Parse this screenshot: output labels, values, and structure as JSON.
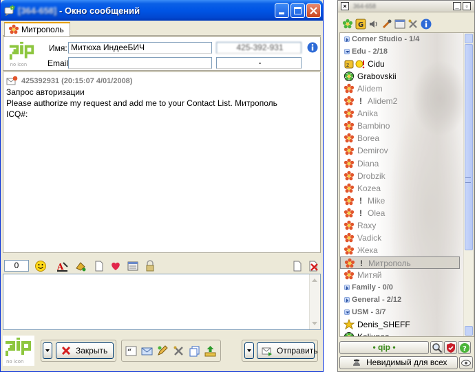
{
  "chat_window": {
    "title_uin": "[364-658]",
    "title_text": "- Окно сообщений",
    "tab_label": "Митрополь",
    "info": {
      "name_label": "Имя:",
      "name_value": "Митюха  ИндееБИЧ",
      "uin_value": "425-392-931",
      "email_label": "Email:",
      "email_value": "",
      "extra_value": "-"
    },
    "message": {
      "header": "425392931 (20:15:07 4/01/2008)",
      "lines": [
        "Запрос авторизации",
        "Please authorize my request and add me to your Contact List. Митрополь",
        "ICQ#:"
      ]
    },
    "char_counter": "0",
    "input_value": "",
    "buttons": {
      "close_label": "Закрыть",
      "send_label": "Отправить"
    }
  },
  "contact_list": {
    "title_uin": "364-658",
    "rows": [
      {
        "type": "group",
        "label": "Corner Studio - 1/4",
        "open": false
      },
      {
        "type": "group",
        "label": "Edu - 2/18",
        "open": true
      },
      {
        "type": "contact",
        "label": "Cidu",
        "status": "online",
        "icon": "away-icon"
      },
      {
        "type": "contact",
        "label": "Grabovskii",
        "status": "online",
        "icon": "online-icon"
      },
      {
        "type": "contact",
        "label": "Alidem",
        "status": "offline",
        "icon": "offline-flower-icon"
      },
      {
        "type": "contact",
        "label": "Alidem2",
        "status": "offline",
        "icon": "offline-flower-icon",
        "note": "!"
      },
      {
        "type": "contact",
        "label": "Anika",
        "status": "offline",
        "icon": "offline-flower-icon"
      },
      {
        "type": "contact",
        "label": "Bambino",
        "status": "offline",
        "icon": "offline-flower-icon"
      },
      {
        "type": "contact",
        "label": "Borea",
        "status": "offline",
        "icon": "offline-flower-icon"
      },
      {
        "type": "contact",
        "label": "Demirov",
        "status": "offline",
        "icon": "offline-flower-icon"
      },
      {
        "type": "contact",
        "label": "Diana",
        "status": "offline",
        "icon": "offline-flower-icon"
      },
      {
        "type": "contact",
        "label": "Drobzik",
        "status": "offline",
        "icon": "offline-flower-icon"
      },
      {
        "type": "contact",
        "label": "Kozea",
        "status": "offline",
        "icon": "offline-flower-icon"
      },
      {
        "type": "contact",
        "label": "Mike",
        "status": "offline",
        "icon": "offline-flower-icon",
        "note": "!"
      },
      {
        "type": "contact",
        "label": "Olea",
        "status": "offline",
        "icon": "offline-flower-icon",
        "note": "!"
      },
      {
        "type": "contact",
        "label": "Raxy",
        "status": "offline",
        "icon": "offline-flower-icon"
      },
      {
        "type": "contact",
        "label": "Vadick",
        "status": "offline",
        "icon": "offline-flower-icon"
      },
      {
        "type": "contact",
        "label": "Жека",
        "status": "offline",
        "icon": "offline-flower-icon"
      },
      {
        "type": "contact",
        "label": "Митрополь",
        "status": "offline",
        "icon": "offline-flower-icon",
        "note": "!",
        "selected": true
      },
      {
        "type": "contact",
        "label": "Митяй",
        "status": "offline",
        "icon": "offline-flower-icon"
      },
      {
        "type": "group",
        "label": "Family - 0/0",
        "open": false
      },
      {
        "type": "group",
        "label": "General - 2/12",
        "open": false
      },
      {
        "type": "group",
        "label": "USM - 3/7",
        "open": true
      },
      {
        "type": "contact",
        "label": "Denis_SHEFF",
        "status": "online",
        "icon": "star-icon"
      },
      {
        "type": "contact",
        "label": "Koliunea",
        "status": "online",
        "icon": "online-icon"
      }
    ],
    "qip_button_label": "• qip •",
    "status_label": "Невидимый для всех"
  },
  "colors": {
    "title_blue": "#0055e5",
    "offline_text": "#8a8a8a",
    "flower_red": "#e0502a",
    "qip_green": "#3a8a1a"
  }
}
